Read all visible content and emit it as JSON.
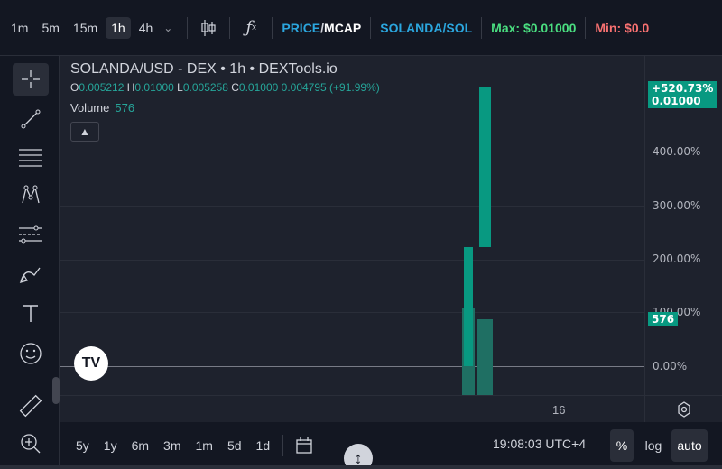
{
  "toolbar": {
    "timeframes": [
      "1m",
      "5m",
      "15m",
      "1h",
      "4h"
    ],
    "active_timeframe": "1h",
    "price_mode": {
      "price": "PRICE",
      "sep": "/",
      "mcap": "MCAP"
    },
    "pair": "SOLANDA/SOL",
    "max_label": "Max:",
    "max_value": "$0.01000",
    "min_label": "Min:",
    "min_value": "$0.0"
  },
  "legend": {
    "title": "SOLANDA/USD - DEX • 1h • DEXTools.io",
    "o_label": "O",
    "o_value": "0.005212",
    "h_label": "H",
    "h_value": "0.01000",
    "l_label": "L",
    "l_value": "0.005258",
    "c_label": "C",
    "c_value": "0.01000",
    "change": "0.004795 (+91.99%)",
    "volume_label": "Volume",
    "volume_value": "576"
  },
  "price_scale": {
    "ticks": [
      "400.00%",
      "300.00%",
      "200.00%",
      "100.00%",
      "0.00%"
    ],
    "last_change": "+520.73%",
    "last_price": "0.01000",
    "volume_tag": "576"
  },
  "time_axis": {
    "ticks": [
      "16"
    ]
  },
  "bottom": {
    "ranges": [
      "5y",
      "1y",
      "6m",
      "3m",
      "1m",
      "5d",
      "1d"
    ],
    "clock": "19:08:03 UTC+4",
    "percent": "%",
    "log": "log",
    "auto": "auto"
  },
  "logo_text": "TV",
  "colors": {
    "up": "#089981",
    "volume": "#26a69a",
    "accent": "#2ba6de",
    "max": "#4ade80",
    "min": "#f87171"
  }
}
